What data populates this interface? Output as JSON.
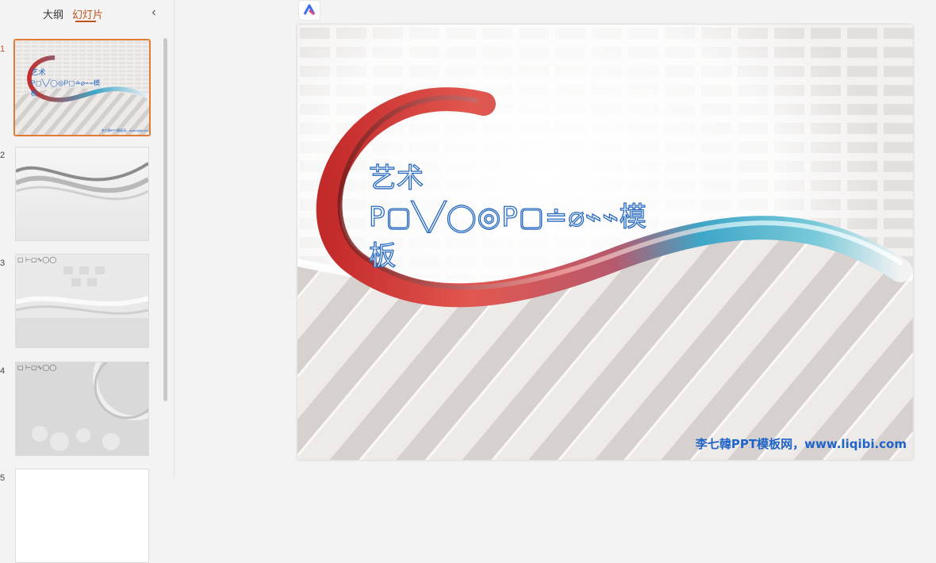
{
  "panel": {
    "tabs": [
      {
        "label": "大纲",
        "active": false
      },
      {
        "label": "幻灯片",
        "active": true
      }
    ],
    "collapse_icon": "chevron-left-icon",
    "accent_color": "#c0531c"
  },
  "thumbnails": [
    {
      "number": "1",
      "title": "艺术\nP▢╲╱◯◎P▢≐⌀⌁⌁模板",
      "footer": "李七韓PPT模板网，www.liqibi.com",
      "active": true
    },
    {
      "number": "2",
      "title": "",
      "active": false
    },
    {
      "number": "3",
      "title": "▢ ⊢▢∿◯◯",
      "active": false
    },
    {
      "number": "4",
      "title": "▢ ⊢▢∿◯◯",
      "active": false
    },
    {
      "number": "5",
      "title": "",
      "active": false
    }
  ],
  "main": {
    "logo_icon": "app-logo-icon",
    "slide_title_line1": "艺术",
    "slide_title_line2": "P▢╲╱◯◎P▢≐⌀⌁⌁模",
    "slide_title_line3": "板",
    "footer_text": "李七韓PPT模板网，www.liqibi.com"
  }
}
